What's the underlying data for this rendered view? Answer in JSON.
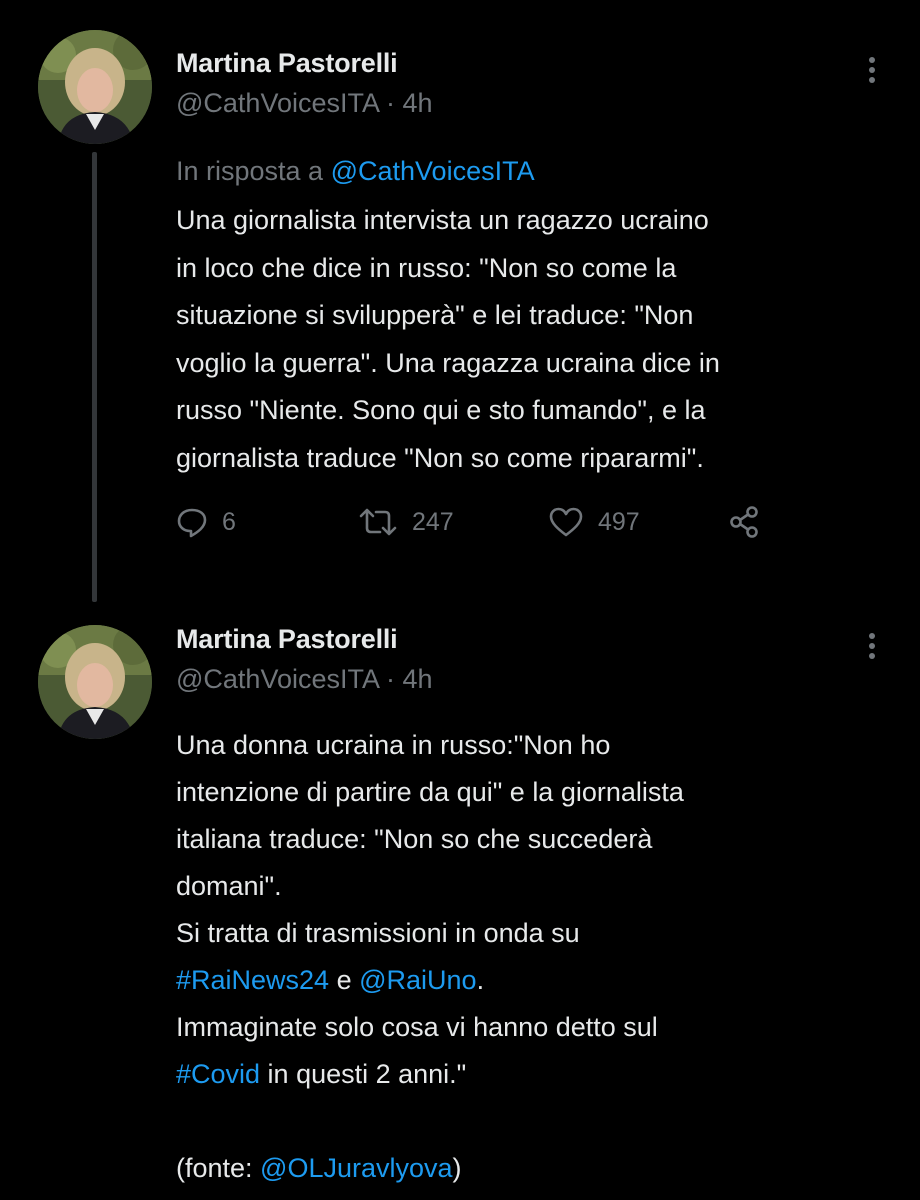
{
  "tweets": [
    {
      "author_name": "Martina Pastorelli",
      "handle": "@CathVoicesITA",
      "separator": "·",
      "time": "4h",
      "reply_prefix": "In risposta a",
      "reply_handle": "@CathVoicesITA",
      "lines": [
        "Una giornalista intervista un ragazzo ucraino",
        "in loco che dice in russo: \"Non so come la",
        "situazione si svilupperà\" e lei traduce: \"Non",
        "voglio la guerra\". Una ragazza ucraina dice in",
        "russo \"Niente. Sono qui e sto fumando\", e la",
        "giornalista traduce \"Non so come ripararmi\"."
      ],
      "replies": "6",
      "retweets": "247",
      "likes": "497"
    },
    {
      "author_name": "Martina Pastorelli",
      "handle": "@CathVoicesITA",
      "separator": "·",
      "time": "4h",
      "lines": [
        "Una donna ucraina in russo:\"Non ho",
        "intenzione di partire da qui\" e la giornalista",
        "italiana traduce: \"Non so che succederà",
        "domani\".",
        "Si tratta di trasmissioni in onda su"
      ],
      "line6": {
        "tag": "#RaiNews24",
        "mid": " e ",
        "mention": "@RaiUno",
        "end": "."
      },
      "line7": "Immaginate solo cosa vi hanno detto sul",
      "line8": {
        "tag": "#Covid",
        "rest": " in questi 2 anni.\""
      },
      "line10": {
        "prefix": "(fonte: ",
        "mention": "@OLJuravlyova",
        "suffix": ")"
      }
    }
  ],
  "icons": {
    "avatar": "avatar-photo",
    "more": "more-vertical-icon",
    "reply": "reply-icon",
    "retweet": "retweet-icon",
    "like": "heart-icon",
    "share": "share-icon"
  },
  "colors": {
    "background": "#000000",
    "text": "#e7e9ea",
    "secondary": "#71767b",
    "link": "#1d9bf0"
  }
}
